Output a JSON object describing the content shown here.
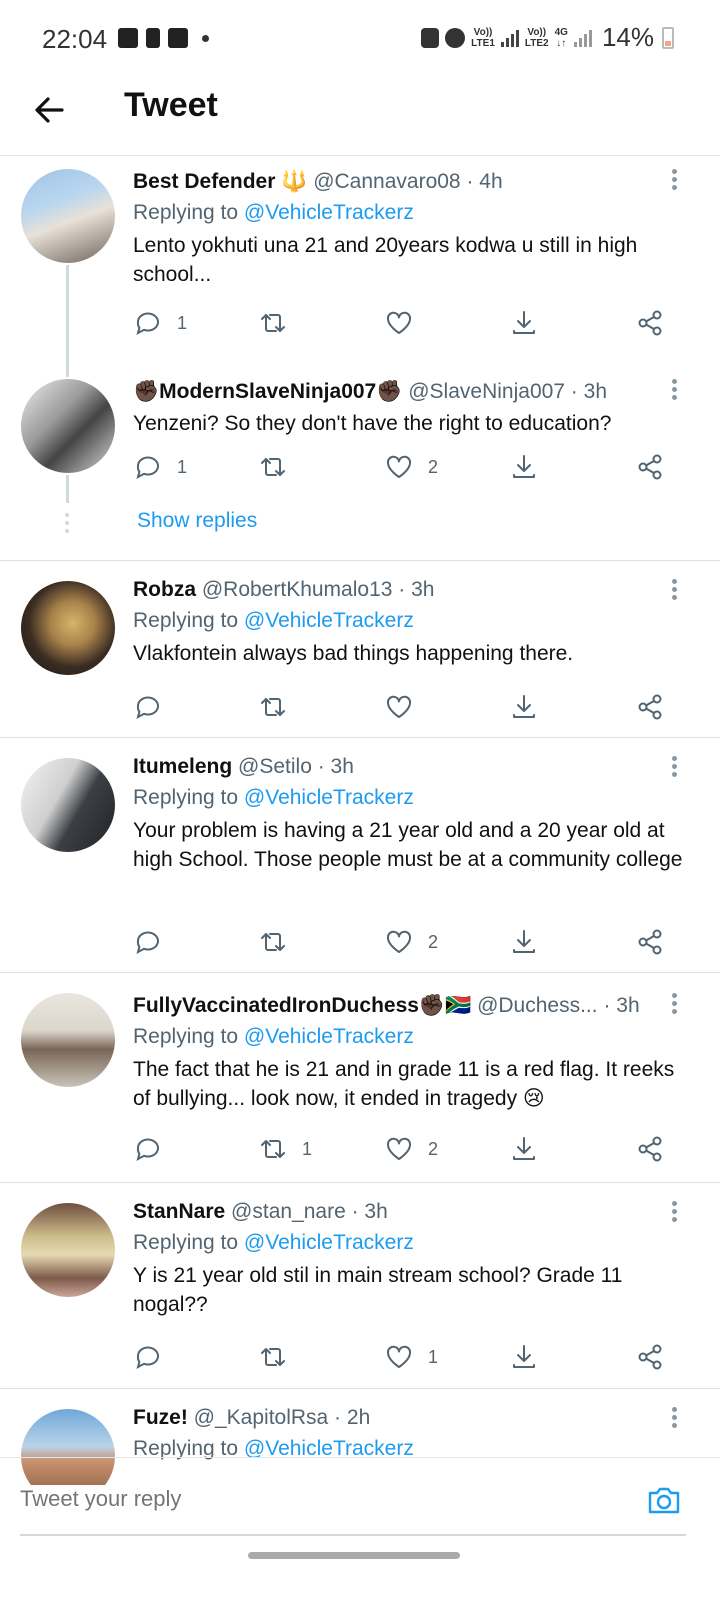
{
  "status": {
    "time": "22:04",
    "net1_top": "Vo))",
    "net1_bottom": "LTE1",
    "net2_top": "Vo))",
    "net2_bottom": "LTE2",
    "net3": "4G",
    "battery": "14%"
  },
  "header": {
    "title": "Tweet"
  },
  "tweets": [
    {
      "name": "Best Defender 🔱",
      "handle": "@Cannavaro08 · 4h",
      "replying_prefix": "Replying to ",
      "replying_to": "@VehicleTrackerz",
      "text": "Lento yokhuti una 21 and 20years kodwa u still in high school...",
      "reply_count": "1",
      "retweet_count": "",
      "like_count": ""
    },
    {
      "name": "✊🏿ModernSlaveNinja007✊🏿",
      "handle": "@SlaveNinja007 · 3h",
      "text": "Yenzeni? So they don't have the right to education?",
      "reply_count": "1",
      "retweet_count": "",
      "like_count": "2",
      "show_replies": "Show replies"
    },
    {
      "name": "Robza",
      "handle": "@RobertKhumalo13 · 3h",
      "replying_prefix": "Replying to ",
      "replying_to": "@VehicleTrackerz",
      "text": "Vlakfontein always bad things happening there.",
      "reply_count": "",
      "retweet_count": "",
      "like_count": ""
    },
    {
      "name": "Itumeleng",
      "handle": "@Setilo · 3h",
      "replying_prefix": "Replying to ",
      "replying_to": "@VehicleTrackerz",
      "text": "Your problem is having a 21 year old and a 20 year old at high School. Those people must be at a community college",
      "reply_count": "",
      "retweet_count": "",
      "like_count": "2"
    },
    {
      "name": "FullyVaccinatedIronDuchess✊🏿🇿🇦",
      "handle": "@Duchess...",
      "time": "· 3h",
      "replying_prefix": "Replying to ",
      "replying_to": "@VehicleTrackerz",
      "text": "The fact that he is 21 and in grade 11 is a red flag. It reeks of bullying... look now, it ended in tragedy 😢",
      "reply_count": "",
      "retweet_count": "1",
      "like_count": "2"
    },
    {
      "name": "StanNare",
      "handle": "@stan_nare · 3h",
      "replying_prefix": "Replying to ",
      "replying_to": "@VehicleTrackerz",
      "text": "Y is 21 year old stil in main stream school? Grade 11 nogal??",
      "reply_count": "",
      "retweet_count": "",
      "like_count": "1"
    },
    {
      "name": "Fuze!",
      "handle": "@_KapitolRsa · 2h",
      "replying_prefix": "Replying to ",
      "replying_to": "@VehicleTrackerz"
    }
  ],
  "reply_bar": {
    "placeholder": "Tweet your reply"
  },
  "colors": {
    "link": "#1d9bf0",
    "muted": "#536471"
  }
}
